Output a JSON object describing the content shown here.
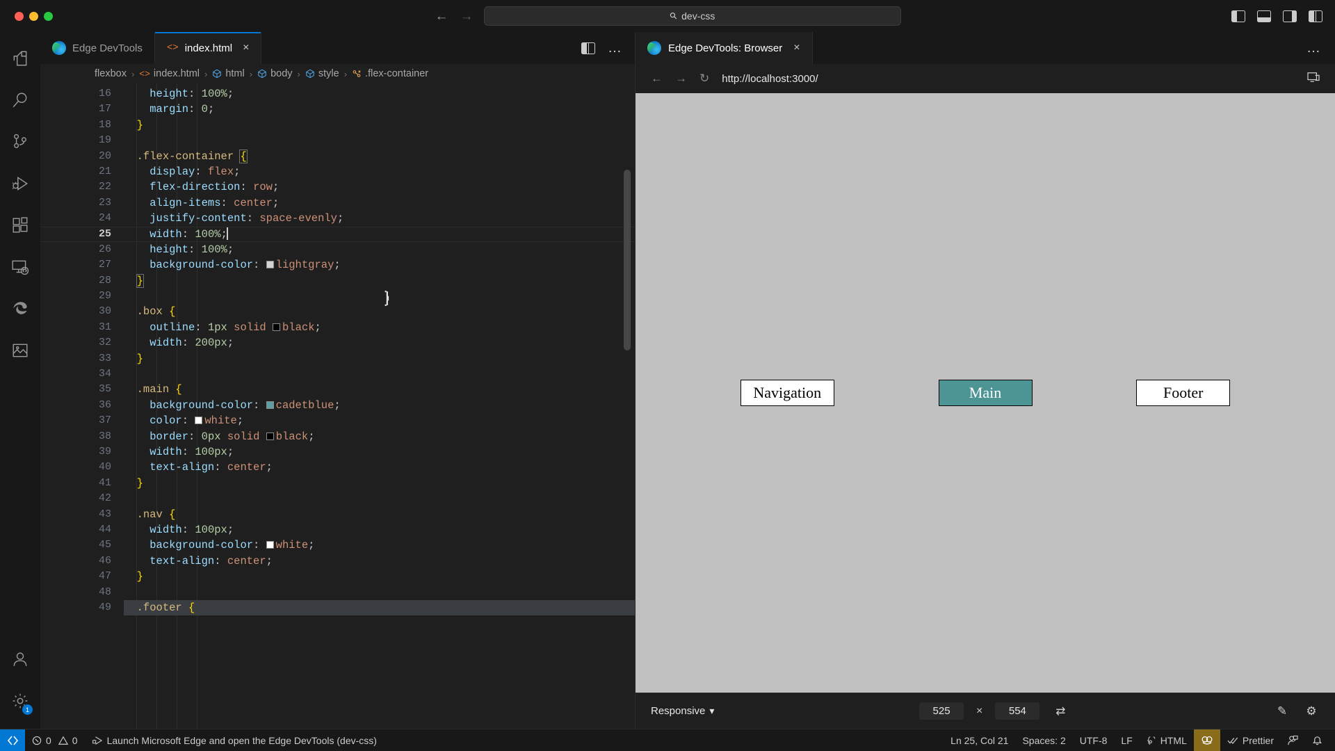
{
  "titlebar": {
    "back_icon": "arrow-left",
    "forward_icon": "arrow-right",
    "search_value": "dev-css",
    "search_icon": "search-icon",
    "layout_icons": [
      "panel-left-icon",
      "panel-bottom-icon",
      "panel-right-icon",
      "editor-layout-icon"
    ]
  },
  "activitybar": {
    "items": [
      {
        "name": "explorer",
        "icon": "files-icon"
      },
      {
        "name": "search",
        "icon": "search-icon"
      },
      {
        "name": "source-control",
        "icon": "source-control-icon"
      },
      {
        "name": "run-and-debug",
        "icon": "run-debug-icon"
      },
      {
        "name": "extensions",
        "icon": "extensions-icon"
      },
      {
        "name": "remote-explorer",
        "icon": "remote-explorer-icon"
      },
      {
        "name": "edge-devtools",
        "icon": "edge-logo-icon"
      },
      {
        "name": "image-preview",
        "icon": "image-icon"
      }
    ],
    "bottom": [
      {
        "name": "accounts",
        "icon": "account-icon"
      },
      {
        "name": "settings",
        "icon": "gear-icon",
        "badge": "1"
      }
    ]
  },
  "editor": {
    "tabs": [
      {
        "label": "Edge DevTools",
        "icon": "edge-logo-icon",
        "active": false,
        "closable": false
      },
      {
        "label": "index.html",
        "icon": "html-code-icon",
        "active": true,
        "closable": true,
        "close_label": "×"
      }
    ],
    "actions": {
      "split_icon": "split-editor-icon",
      "more_label": "…"
    },
    "breadcrumb": [
      {
        "label": "flexbox",
        "icon": ""
      },
      {
        "label": "index.html",
        "icon": "html-code-icon"
      },
      {
        "label": "html",
        "icon": "symbol-cube-icon"
      },
      {
        "label": "body",
        "icon": "symbol-cube-icon"
      },
      {
        "label": "style",
        "icon": "symbol-cube-icon"
      },
      {
        "label": ".flex-container",
        "icon": "symbol-ruler-icon"
      }
    ],
    "breadcrumb_separator": "›",
    "first_line_number": 16,
    "current_line": 25,
    "lines": [
      {
        "n": 16,
        "tokens": [
          {
            "t": "    ",
            "c": "punc"
          },
          {
            "t": "height",
            "c": "prop"
          },
          {
            "t": ": ",
            "c": "punc"
          },
          {
            "t": "100%",
            "c": "num"
          },
          {
            "t": ";",
            "c": "punc"
          }
        ]
      },
      {
        "n": 17,
        "tokens": [
          {
            "t": "    ",
            "c": "punc"
          },
          {
            "t": "margin",
            "c": "prop"
          },
          {
            "t": ": ",
            "c": "punc"
          },
          {
            "t": "0",
            "c": "num"
          },
          {
            "t": ";",
            "c": "punc"
          }
        ]
      },
      {
        "n": 18,
        "tokens": [
          {
            "t": "  ",
            "c": "punc"
          },
          {
            "t": "}",
            "c": "brace"
          }
        ]
      },
      {
        "n": 19,
        "tokens": []
      },
      {
        "n": 20,
        "tokens": [
          {
            "t": "  ",
            "c": "punc"
          },
          {
            "t": ".flex-container ",
            "c": "sel"
          },
          {
            "t": "{",
            "c": "brace-hl"
          }
        ]
      },
      {
        "n": 21,
        "tokens": [
          {
            "t": "    ",
            "c": "punc"
          },
          {
            "t": "display",
            "c": "prop"
          },
          {
            "t": ": ",
            "c": "punc"
          },
          {
            "t": "flex",
            "c": "val"
          },
          {
            "t": ";",
            "c": "punc"
          }
        ]
      },
      {
        "n": 22,
        "tokens": [
          {
            "t": "    ",
            "c": "punc"
          },
          {
            "t": "flex-direction",
            "c": "prop"
          },
          {
            "t": ": ",
            "c": "punc"
          },
          {
            "t": "row",
            "c": "val"
          },
          {
            "t": ";",
            "c": "punc"
          }
        ]
      },
      {
        "n": 23,
        "tokens": [
          {
            "t": "    ",
            "c": "punc"
          },
          {
            "t": "align-items",
            "c": "prop"
          },
          {
            "t": ": ",
            "c": "punc"
          },
          {
            "t": "center",
            "c": "val"
          },
          {
            "t": ";",
            "c": "punc"
          }
        ]
      },
      {
        "n": 24,
        "tokens": [
          {
            "t": "    ",
            "c": "punc"
          },
          {
            "t": "justify-content",
            "c": "prop"
          },
          {
            "t": ": ",
            "c": "punc"
          },
          {
            "t": "space-evenly",
            "c": "val"
          },
          {
            "t": ";",
            "c": "punc"
          }
        ]
      },
      {
        "n": 25,
        "tokens": [
          {
            "t": "    ",
            "c": "punc"
          },
          {
            "t": "width",
            "c": "prop"
          },
          {
            "t": ": ",
            "c": "punc"
          },
          {
            "t": "100%",
            "c": "num"
          },
          {
            "t": ";",
            "c": "punc"
          }
        ],
        "caret": true
      },
      {
        "n": 26,
        "tokens": [
          {
            "t": "    ",
            "c": "punc"
          },
          {
            "t": "height",
            "c": "prop"
          },
          {
            "t": ": ",
            "c": "punc"
          },
          {
            "t": "100%",
            "c": "num"
          },
          {
            "t": ";",
            "c": "punc"
          }
        ]
      },
      {
        "n": 27,
        "tokens": [
          {
            "t": "    ",
            "c": "punc"
          },
          {
            "t": "background-color",
            "c": "prop"
          },
          {
            "t": ": ",
            "c": "punc"
          },
          {
            "t": "lightgray",
            "c": "val",
            "swatch": "#d3d3d3"
          },
          {
            "t": ";",
            "c": "punc"
          }
        ]
      },
      {
        "n": 28,
        "tokens": [
          {
            "t": "  ",
            "c": "punc"
          },
          {
            "t": "}",
            "c": "brace-hl"
          }
        ]
      },
      {
        "n": 29,
        "tokens": []
      },
      {
        "n": 30,
        "tokens": [
          {
            "t": "  ",
            "c": "punc"
          },
          {
            "t": ".box ",
            "c": "sel"
          },
          {
            "t": "{",
            "c": "brace"
          }
        ]
      },
      {
        "n": 31,
        "tokens": [
          {
            "t": "    ",
            "c": "punc"
          },
          {
            "t": "outline",
            "c": "prop"
          },
          {
            "t": ": ",
            "c": "punc"
          },
          {
            "t": "1px",
            "c": "num"
          },
          {
            "t": " ",
            "c": "punc"
          },
          {
            "t": "solid",
            "c": "val"
          },
          {
            "t": " ",
            "c": "punc"
          },
          {
            "t": "black",
            "c": "val",
            "swatch": "#000000"
          },
          {
            "t": ";",
            "c": "punc"
          }
        ]
      },
      {
        "n": 32,
        "tokens": [
          {
            "t": "    ",
            "c": "punc"
          },
          {
            "t": "width",
            "c": "prop"
          },
          {
            "t": ": ",
            "c": "punc"
          },
          {
            "t": "200px",
            "c": "num"
          },
          {
            "t": ";",
            "c": "punc"
          }
        ]
      },
      {
        "n": 33,
        "tokens": [
          {
            "t": "  ",
            "c": "punc"
          },
          {
            "t": "}",
            "c": "brace"
          }
        ]
      },
      {
        "n": 34,
        "tokens": []
      },
      {
        "n": 35,
        "tokens": [
          {
            "t": "  ",
            "c": "punc"
          },
          {
            "t": ".main ",
            "c": "sel"
          },
          {
            "t": "{",
            "c": "brace"
          }
        ]
      },
      {
        "n": 36,
        "tokens": [
          {
            "t": "    ",
            "c": "punc"
          },
          {
            "t": "background-color",
            "c": "prop"
          },
          {
            "t": ": ",
            "c": "punc"
          },
          {
            "t": "cadetblue",
            "c": "val",
            "swatch": "#5f9ea0"
          },
          {
            "t": ";",
            "c": "punc"
          }
        ]
      },
      {
        "n": 37,
        "tokens": [
          {
            "t": "    ",
            "c": "punc"
          },
          {
            "t": "color",
            "c": "prop"
          },
          {
            "t": ": ",
            "c": "punc"
          },
          {
            "t": "white",
            "c": "val",
            "swatch": "#ffffff"
          },
          {
            "t": ";",
            "c": "punc"
          }
        ]
      },
      {
        "n": 38,
        "tokens": [
          {
            "t": "    ",
            "c": "punc"
          },
          {
            "t": "border",
            "c": "prop"
          },
          {
            "t": ": ",
            "c": "punc"
          },
          {
            "t": "0px",
            "c": "num"
          },
          {
            "t": " ",
            "c": "punc"
          },
          {
            "t": "solid",
            "c": "val"
          },
          {
            "t": " ",
            "c": "punc"
          },
          {
            "t": "black",
            "c": "val",
            "swatch": "#000000"
          },
          {
            "t": ";",
            "c": "punc"
          }
        ]
      },
      {
        "n": 39,
        "tokens": [
          {
            "t": "    ",
            "c": "punc"
          },
          {
            "t": "width",
            "c": "prop"
          },
          {
            "t": ": ",
            "c": "punc"
          },
          {
            "t": "100px",
            "c": "num"
          },
          {
            "t": ";",
            "c": "punc"
          }
        ]
      },
      {
        "n": 40,
        "tokens": [
          {
            "t": "    ",
            "c": "punc"
          },
          {
            "t": "text-align",
            "c": "prop"
          },
          {
            "t": ": ",
            "c": "punc"
          },
          {
            "t": "center",
            "c": "val"
          },
          {
            "t": ";",
            "c": "punc"
          }
        ]
      },
      {
        "n": 41,
        "tokens": [
          {
            "t": "  ",
            "c": "punc"
          },
          {
            "t": "}",
            "c": "brace"
          }
        ]
      },
      {
        "n": 42,
        "tokens": []
      },
      {
        "n": 43,
        "tokens": [
          {
            "t": "  ",
            "c": "punc"
          },
          {
            "t": ".nav ",
            "c": "sel"
          },
          {
            "t": "{",
            "c": "brace"
          }
        ]
      },
      {
        "n": 44,
        "tokens": [
          {
            "t": "    ",
            "c": "punc"
          },
          {
            "t": "width",
            "c": "prop"
          },
          {
            "t": ": ",
            "c": "punc"
          },
          {
            "t": "100px",
            "c": "num"
          },
          {
            "t": ";",
            "c": "punc"
          }
        ]
      },
      {
        "n": 45,
        "tokens": [
          {
            "t": "    ",
            "c": "punc"
          },
          {
            "t": "background-color",
            "c": "prop"
          },
          {
            "t": ": ",
            "c": "punc"
          },
          {
            "t": "white",
            "c": "val",
            "swatch": "#ffffff"
          },
          {
            "t": ";",
            "c": "punc"
          }
        ]
      },
      {
        "n": 46,
        "tokens": [
          {
            "t": "    ",
            "c": "punc"
          },
          {
            "t": "text-align",
            "c": "prop"
          },
          {
            "t": ": ",
            "c": "punc"
          },
          {
            "t": "center",
            "c": "val"
          },
          {
            "t": ";",
            "c": "punc"
          }
        ]
      },
      {
        "n": 47,
        "tokens": [
          {
            "t": "  ",
            "c": "punc"
          },
          {
            "t": "}",
            "c": "brace"
          }
        ]
      },
      {
        "n": 48,
        "tokens": []
      },
      {
        "n": 49,
        "tokens": [
          {
            "t": "  ",
            "c": "punc"
          },
          {
            "t": ".footer ",
            "c": "sel"
          },
          {
            "t": "{",
            "c": "brace"
          }
        ],
        "findmatch": true
      }
    ]
  },
  "browser": {
    "tab_label": "Edge DevTools: Browser",
    "tab_icon": "edge-logo-icon",
    "tab_close": "×",
    "more_label": "…",
    "back_icon": "arrow-left",
    "forward_icon": "arrow-right",
    "reload_icon": "reload-icon",
    "url": "http://localhost:3000/",
    "screencast_icon": "screencast-icon",
    "preview": {
      "boxes": [
        {
          "label": "Navigation",
          "class": "nav"
        },
        {
          "label": "Main",
          "class": "main"
        },
        {
          "label": "Footer",
          "class": "footer"
        }
      ],
      "container_background": "#c0c0c0",
      "main_background": "#4d9494"
    },
    "bottombar": {
      "device_label": "Responsive",
      "device_chevron": "⌄",
      "width": "525",
      "separator": "×",
      "height": "554",
      "rotate_icon": "swap-dimensions-icon",
      "inspect_icon": "inspect-icon",
      "settings_icon": "gear-icon"
    }
  },
  "statusbar": {
    "remote_icon": "remote-window-icon",
    "errors_icon": "error-icon",
    "errors": "0",
    "warnings_icon": "warning-icon",
    "warnings": "0",
    "task_icon": "debug-task-icon",
    "task_label": "Launch Microsoft Edge and open the Edge DevTools (dev-css)",
    "position": "Ln 25, Col 21",
    "indentation": "Spaces: 2",
    "encoding": "UTF-8",
    "eol": "LF",
    "language_icon": "html-braces-icon",
    "language": "HTML",
    "devtools_icon": "edge-devtools-badge-icon",
    "formatter_icon": "check-check-icon",
    "formatter": "Prettier",
    "feedback_icon": "feedback-icon",
    "notifications_icon": "bell-icon"
  }
}
